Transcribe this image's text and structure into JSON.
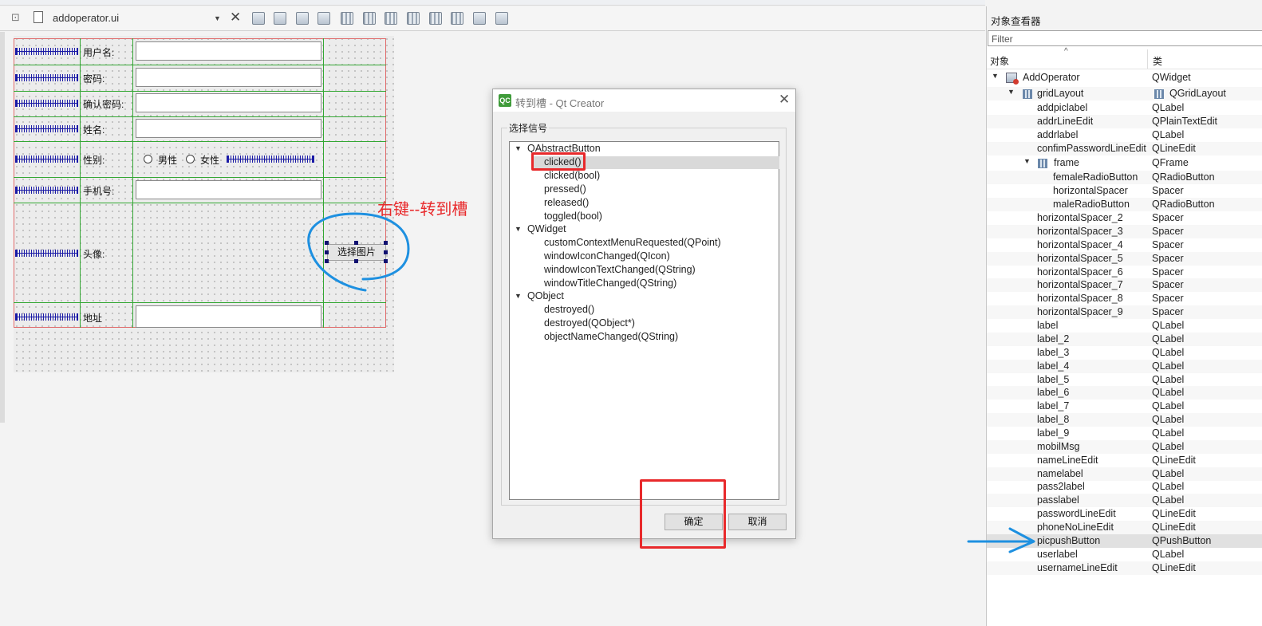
{
  "editor": {
    "file_name": "addoperator.ui",
    "toolbar_icons": [
      "edit-widgets-icon",
      "edit-signals-icon",
      "edit-buddies-icon",
      "edit-tab-order-icon",
      "layout-horizontal-icon",
      "layout-vertical-icon",
      "layout-hsplit-icon",
      "layout-vsplit-icon",
      "layout-grid-icon",
      "layout-form-icon",
      "break-layout-icon",
      "adjust-size-icon"
    ]
  },
  "form": {
    "rows": [
      {
        "label": "用户名:",
        "widget": "line-edit"
      },
      {
        "label": "密码:",
        "widget": "line-edit"
      },
      {
        "label": "确认密码:",
        "widget": "line-edit"
      },
      {
        "label": "姓名:",
        "widget": "line-edit"
      },
      {
        "label": "性别:",
        "widget": "radio-group"
      },
      {
        "label": "手机号:",
        "widget": "line-edit"
      },
      {
        "label": "头像:",
        "widget": "push-button"
      },
      {
        "label": "地址",
        "widget": "line-edit"
      }
    ],
    "radio_male": "男性",
    "radio_female": "女性",
    "pic_button": "选择图片"
  },
  "annotation": {
    "text": "右键--转到槽",
    "color": "#e8292b",
    "circle_color": "#1e90e0"
  },
  "dialog": {
    "title": "转到槽 - Qt Creator",
    "app_icon_text": "QC",
    "group_title": "选择信号",
    "signal_groups": [
      {
        "name": "QAbstractButton",
        "signals": [
          "clicked()",
          "clicked(bool)",
          "pressed()",
          "released()",
          "toggled(bool)"
        ]
      },
      {
        "name": "QWidget",
        "signals": [
          "customContextMenuRequested(QPoint)",
          "windowIconChanged(QIcon)",
          "windowIconTextChanged(QString)",
          "windowTitleChanged(QString)"
        ]
      },
      {
        "name": "QObject",
        "signals": [
          "destroyed()",
          "destroyed(QObject*)",
          "objectNameChanged(QString)"
        ]
      }
    ],
    "selected_signal": "clicked()",
    "ok_label": "确定",
    "cancel_label": "取消"
  },
  "inspector": {
    "title": "对象查看器",
    "filter_placeholder": "Filter",
    "col_object": "对象",
    "col_class": "类",
    "rows": [
      {
        "name": "AddOperator",
        "cls": "QWidget"
      },
      {
        "name": "gridLayout",
        "cls": "QGridLayout"
      },
      {
        "name": "addpiclabel",
        "cls": "QLabel"
      },
      {
        "name": "addrLineEdit",
        "cls": "QPlainTextEdit"
      },
      {
        "name": "addrlabel",
        "cls": "QLabel"
      },
      {
        "name": "confimPasswordLineEdit",
        "cls": "QLineEdit"
      },
      {
        "name": "frame",
        "cls": "QFrame"
      },
      {
        "name": "femaleRadioButton",
        "cls": "QRadioButton"
      },
      {
        "name": "horizontalSpacer",
        "cls": "Spacer"
      },
      {
        "name": "maleRadioButton",
        "cls": "QRadioButton"
      },
      {
        "name": "horizontalSpacer_2",
        "cls": "Spacer"
      },
      {
        "name": "horizontalSpacer_3",
        "cls": "Spacer"
      },
      {
        "name": "horizontalSpacer_4",
        "cls": "Spacer"
      },
      {
        "name": "horizontalSpacer_5",
        "cls": "Spacer"
      },
      {
        "name": "horizontalSpacer_6",
        "cls": "Spacer"
      },
      {
        "name": "horizontalSpacer_7",
        "cls": "Spacer"
      },
      {
        "name": "horizontalSpacer_8",
        "cls": "Spacer"
      },
      {
        "name": "horizontalSpacer_9",
        "cls": "Spacer"
      },
      {
        "name": "label",
        "cls": "QLabel"
      },
      {
        "name": "label_2",
        "cls": "QLabel"
      },
      {
        "name": "label_3",
        "cls": "QLabel"
      },
      {
        "name": "label_4",
        "cls": "QLabel"
      },
      {
        "name": "label_5",
        "cls": "QLabel"
      },
      {
        "name": "label_6",
        "cls": "QLabel"
      },
      {
        "name": "label_7",
        "cls": "QLabel"
      },
      {
        "name": "label_8",
        "cls": "QLabel"
      },
      {
        "name": "label_9",
        "cls": "QLabel"
      },
      {
        "name": "mobilMsg",
        "cls": "QLabel"
      },
      {
        "name": "nameLineEdit",
        "cls": "QLineEdit"
      },
      {
        "name": "namelabel",
        "cls": "QLabel"
      },
      {
        "name": "pass2label",
        "cls": "QLabel"
      },
      {
        "name": "passlabel",
        "cls": "QLabel"
      },
      {
        "name": "passwordLineEdit",
        "cls": "QLineEdit"
      },
      {
        "name": "phoneNoLineEdit",
        "cls": "QLineEdit"
      },
      {
        "name": "picpushButton",
        "cls": "QPushButton"
      },
      {
        "name": "userlabel",
        "cls": "QLabel"
      },
      {
        "name": "usernameLineEdit",
        "cls": "QLineEdit"
      }
    ],
    "selected_row": "picpushButton"
  }
}
